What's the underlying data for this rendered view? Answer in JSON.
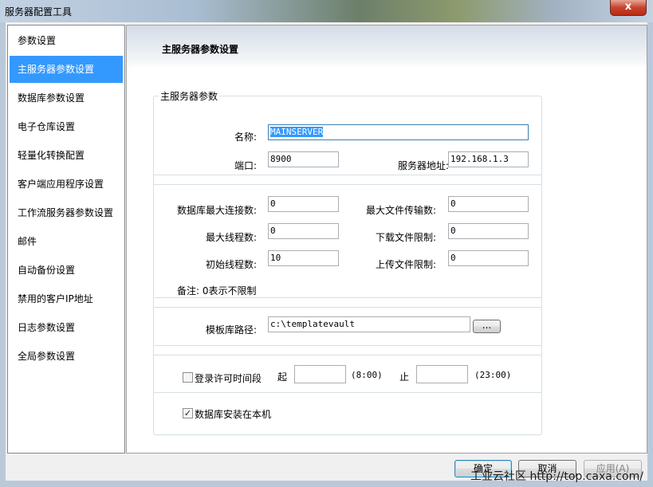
{
  "window": {
    "title": "服务器配置工具",
    "close_glyph": "x"
  },
  "sidebar": {
    "items": [
      {
        "label": "参数设置",
        "selected": false
      },
      {
        "label": "主服务器参数设置",
        "selected": true
      },
      {
        "label": "数据库参数设置",
        "selected": false
      },
      {
        "label": "电子仓库设置",
        "selected": false
      },
      {
        "label": "轻量化转换配置",
        "selected": false
      },
      {
        "label": "客户端应用程序设置",
        "selected": false
      },
      {
        "label": "工作流服务器参数设置",
        "selected": false
      },
      {
        "label": "邮件",
        "selected": false
      },
      {
        "label": "自动备份设置",
        "selected": false
      },
      {
        "label": "禁用的客户IP地址",
        "selected": false
      },
      {
        "label": "日志参数设置",
        "selected": false
      },
      {
        "label": "全局参数设置",
        "selected": false
      }
    ]
  },
  "panel": {
    "title": "主服务器参数设置",
    "group_title": "主服务器参数",
    "name_label": "名称:",
    "name_value": "MAINSERVER",
    "port_label": "端口:",
    "port_value": "8900",
    "address_label": "服务器地址:",
    "address_value": "192.168.1.3",
    "max_db_conn_label": "数据库最大连接数:",
    "max_db_conn_value": "0",
    "max_file_transfer_label": "最大文件传输数:",
    "max_file_transfer_value": "0",
    "max_threads_label": "最大线程数:",
    "max_threads_value": "0",
    "download_limit_label": "下载文件限制:",
    "download_limit_value": "0",
    "init_threads_label": "初始线程数:",
    "init_threads_value": "10",
    "upload_limit_label": "上传文件限制:",
    "upload_limit_value": "0",
    "note": "备注: 0表示不限制",
    "template_path_label": "模板库路径:",
    "template_path_value": "c:\\templatevault",
    "browse_label": "...",
    "login_window_label": "登录许可时间段",
    "login_window_checked": false,
    "from_label": "起",
    "from_value": "",
    "from_hint": "(8:00)",
    "to_label": "止",
    "to_value": "",
    "to_hint": "(23:00)",
    "db_local_label": "数据库安装在本机",
    "db_local_checked": true
  },
  "footer": {
    "ok_label": "确定",
    "cancel_label": "取消",
    "apply_label": "应用(A)"
  },
  "watermark": "工业云社区 http://top.caxa.com/"
}
